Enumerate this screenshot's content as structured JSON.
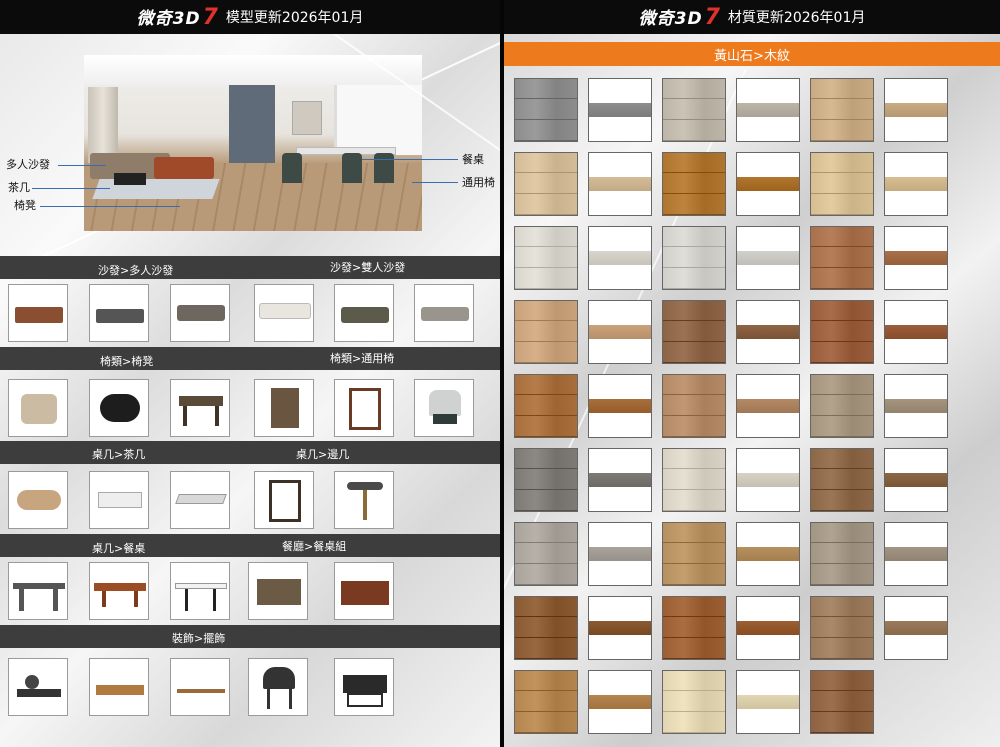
{
  "header": {
    "left": {
      "brand_text": "微奇3D",
      "brand_num": "7",
      "title": "模型更新2026年01月"
    },
    "right": {
      "brand_text": "微奇3D",
      "brand_num": "7",
      "title": "材質更新2026年01月"
    }
  },
  "scene_callouts": {
    "multi_sofa": "多人沙發",
    "coffee_table": "茶几",
    "stool": "椅凳",
    "dining_table": "餐桌",
    "general_chair": "通用椅"
  },
  "sections": [
    {
      "labels": [
        "沙發>多人沙發",
        "沙發>雙人沙發"
      ],
      "items": [
        "sofa-1",
        "sofa-2",
        "sofa-3",
        "sofa-4",
        "sofa-5",
        "sofa-6"
      ]
    },
    {
      "labels": [
        "椅類>椅凳",
        "椅類>通用椅"
      ],
      "items": [
        "ottoman",
        "pig-stool",
        "bench",
        "armchair-1",
        "armchair-2",
        "armchair-3"
      ]
    },
    {
      "labels": [
        "桌几>茶几",
        "桌几>邊几"
      ],
      "items": [
        "coffee-table-1",
        "coffee-table-2",
        "coffee-table-3",
        "side-table-1",
        "side-table-2"
      ]
    },
    {
      "labels": [
        "桌几>餐桌",
        "餐廳>餐桌組"
      ],
      "items": [
        "dining-table-1",
        "dining-table-2",
        "dining-table-3",
        "dining-set-1",
        "dining-set-2"
      ]
    },
    {
      "labels": [
        "裝飾>擺飾"
      ],
      "items": [
        "tea-set",
        "tray-set",
        "decor-set",
        "grill-1",
        "grill-2"
      ]
    }
  ],
  "materials": {
    "category": "黃山石>木紋",
    "colors": [
      [
        "#8d8d8d",
        "#8d8d8d",
        "#bdb5a8",
        "#bdb5a8",
        "#c9ab83",
        "#c9ab83"
      ],
      [
        "#d4bc98",
        "#d4bc98",
        "#b07630",
        "#b07630",
        "#d6be92",
        "#d6be92"
      ],
      [
        "#d8d5cd",
        "#d8d5cd",
        "#d2d0cb",
        "#d2d0cb",
        "#a8714b",
        "#a8714b"
      ],
      [
        "#c9a27c",
        "#c9a27c",
        "#8e6446",
        "#8e6446",
        "#9a5e3c",
        "#9a5e3c"
      ],
      [
        "#a86e3c",
        "#a86e3c",
        "#b48a66",
        "#b48a66",
        "#a5957f",
        "#a5957f"
      ],
      [
        "#7e7b77",
        "#7e7b77",
        "#d8d2c4",
        "#d8d2c4",
        "#8c6848",
        "#8c6848"
      ],
      [
        "#a9a39c",
        "#a9a39c",
        "#b7905f",
        "#b7905f",
        "#a39584",
        "#a39584"
      ],
      [
        "#8a5a32",
        "#8a5a32",
        "#9b5f33",
        "#9b5f33",
        "#9c7a5c",
        "#9c7a5c"
      ],
      [
        "#b58550",
        "#b58550",
        "#e2d5b2",
        "#e2d5b2",
        "#8e6240"
      ]
    ]
  }
}
